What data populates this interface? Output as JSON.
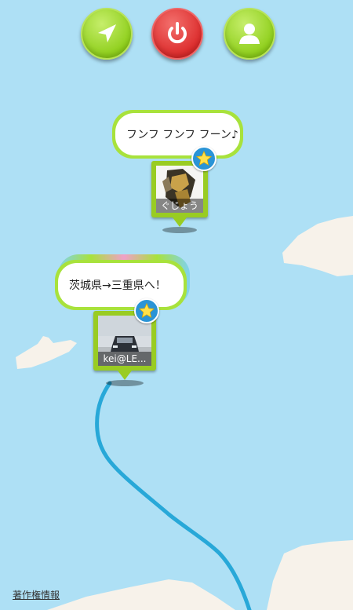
{
  "toolbar": {
    "buttons": [
      {
        "name": "navigate",
        "icon": "navigation-arrow-icon",
        "color": "#8fcf1c"
      },
      {
        "name": "power",
        "icon": "power-icon",
        "color": "#dc2c2c"
      },
      {
        "name": "profile",
        "icon": "user-icon",
        "color": "#8fcf1c"
      }
    ]
  },
  "posts": [
    {
      "bubble_text": "フンフ フンフ フーン♪",
      "user_label": "ぐじょう",
      "badge_icon": "star-icon"
    },
    {
      "bubble_text": "茨城県→三重県へ！",
      "user_label": "kei@LE...",
      "badge_icon": "star-icon"
    }
  ],
  "footer": {
    "copyright_link": "著作権情報"
  },
  "colors": {
    "sea": "#aee0f5",
    "land": "#f7f2ea",
    "route": "#28a8d8",
    "accent_green": "#99cc22"
  }
}
